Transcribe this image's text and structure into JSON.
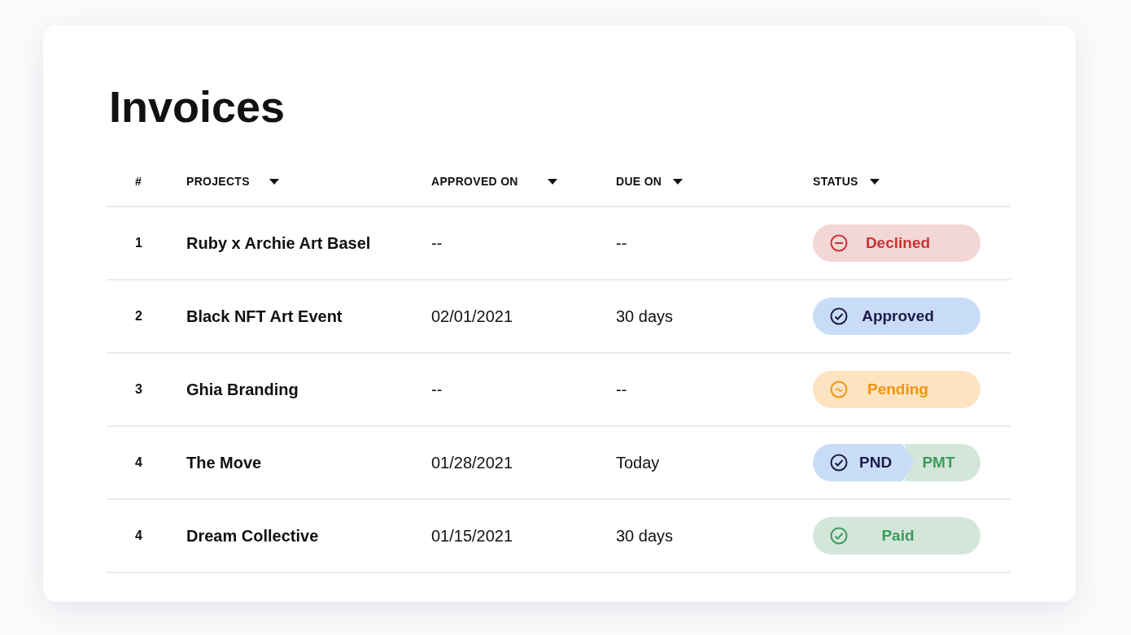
{
  "title": "Invoices",
  "table": {
    "columns": [
      {
        "label": "#",
        "sortable": false
      },
      {
        "label": "PROJECTS",
        "sortable": true
      },
      {
        "label": "APPROVED ON",
        "sortable": true
      },
      {
        "label": "DUE ON",
        "sortable": true
      },
      {
        "label": "STATUS",
        "sortable": true
      }
    ],
    "rows": [
      {
        "number": "1",
        "project": "Ruby x Archie Art Basel",
        "approved_on": "--",
        "due_on": "--",
        "status": {
          "kind": "declined",
          "label": "Declined"
        }
      },
      {
        "number": "2",
        "project": "Black NFT Art Event",
        "approved_on": "02/01/2021",
        "due_on": "30 days",
        "status": {
          "kind": "approved",
          "label": "Approved"
        }
      },
      {
        "number": "3",
        "project": "Ghia Branding",
        "approved_on": "--",
        "due_on": "--",
        "status": {
          "kind": "pending",
          "label": "Pending"
        }
      },
      {
        "number": "4",
        "project": "The Move",
        "approved_on": "01/28/2021",
        "due_on": "Today",
        "status": {
          "kind": "split",
          "label": "PND",
          "second_label": "PMT"
        }
      },
      {
        "number": "4",
        "project": "Dream Collective",
        "approved_on": "01/15/2021",
        "due_on": "30 days",
        "status": {
          "kind": "paid",
          "label": "Paid"
        }
      }
    ]
  }
}
